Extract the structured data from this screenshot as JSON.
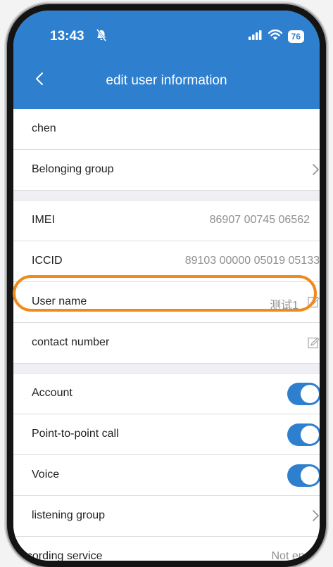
{
  "status_bar": {
    "time": "13:43",
    "battery": "76"
  },
  "header": {
    "title": "edit user information"
  },
  "rows": {
    "name": {
      "label": "chen"
    },
    "belonging_group": {
      "label": "Belonging group"
    },
    "imei": {
      "label": "IMEI",
      "value": "86907 00745 06562"
    },
    "iccid": {
      "label": "ICCID",
      "value": "89103 00000 05019 05133"
    },
    "user_name": {
      "label": "User name",
      "value": "测试1"
    },
    "contact_number": {
      "label": "contact number"
    },
    "account": {
      "label": "Account",
      "enabled": true
    },
    "p2p_call": {
      "label": "Point-to-point call",
      "enabled": true
    },
    "voice": {
      "label": "Voice",
      "enabled": true
    },
    "listening_group": {
      "label": "listening group"
    },
    "recording_service": {
      "label": "ecording service",
      "value": "Not enabl"
    }
  },
  "colors": {
    "brand": "#2f7fcf",
    "highlight": "#f08a1c"
  }
}
